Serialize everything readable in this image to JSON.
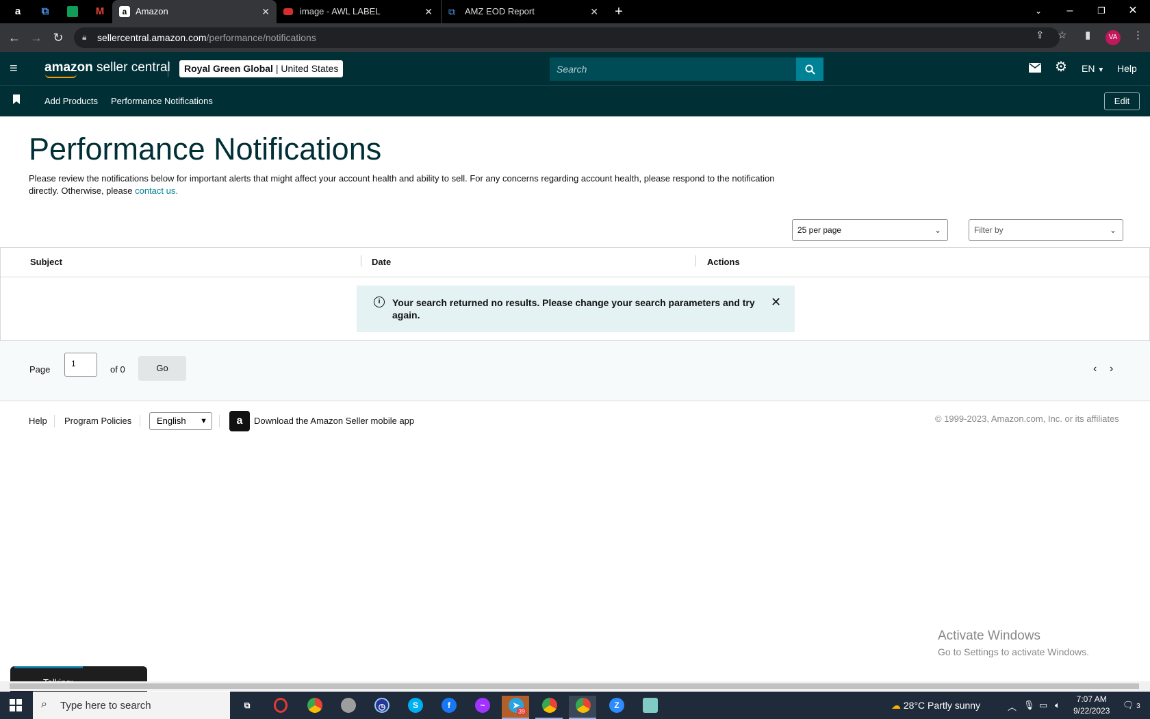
{
  "browser": {
    "tabs": [
      {
        "title": "Amazon",
        "active": true
      },
      {
        "title": "image - AWL LABEL",
        "active": false
      },
      {
        "title": "AMZ EOD Report",
        "active": false
      }
    ],
    "url_host": "sellercentral.amazon.com",
    "url_path": "/performance/notifications",
    "profile_initials": "VA"
  },
  "header": {
    "logo_bold": "amazon",
    "logo_rest": " seller central",
    "store_name": "Royal Green Global",
    "store_sep": " | ",
    "store_region": "United States",
    "search_placeholder": "Search",
    "language": "EN",
    "help": "Help"
  },
  "bookmarks": {
    "items": [
      "Add Products",
      "Performance Notifications"
    ],
    "edit": "Edit"
  },
  "main": {
    "title": "Performance Notifications",
    "description": "Please review the notifications below for important alerts that might affect your account health and ability to sell. For any concerns regarding account health, please respond to the notification directly. Otherwise, please ",
    "contact_link": "contact us.",
    "per_page": "25 per page",
    "filter_placeholder": "Filter by",
    "columns": [
      "Subject",
      "Date",
      "Actions"
    ],
    "alert_message": "Your search returned no results. Please change your search parameters and try again."
  },
  "pagination": {
    "page_label": "Page",
    "current_page": "1",
    "of_label": "of 0",
    "go": "Go"
  },
  "footer": {
    "help": "Help",
    "program_policies": "Program Policies",
    "language": "English",
    "app_link": "Download the Amazon Seller mobile app",
    "copyright": "© 1999-2023, Amazon.com, Inc. or its affiliates"
  },
  "os": {
    "activate_title": "Activate Windows",
    "activate_sub": "Go to Settings to activate Windows.",
    "talking": "Talking:",
    "search_placeholder": "Type here to search",
    "weather": "28°C  Partly sunny",
    "time": "7:07 AM",
    "date": "9/22/2023",
    "telegram_badge": "39",
    "notifications_count": "3"
  },
  "colors": {
    "header_bg": "#002f36",
    "accent": "#008296",
    "alert_bg": "#e4f2f3"
  }
}
